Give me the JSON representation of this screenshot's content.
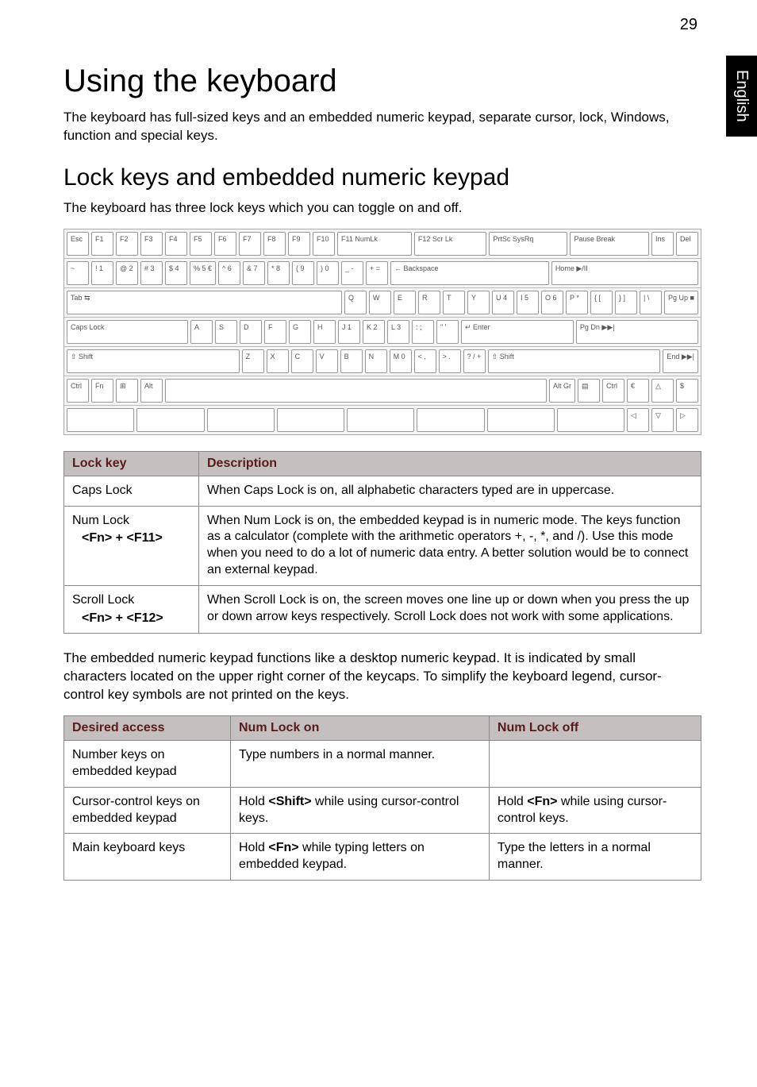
{
  "page_number": "29",
  "side_tab": "English",
  "h1": "Using the keyboard",
  "intro": "The keyboard has full-sized keys and an embedded numeric keypad, separate cursor, lock, Windows, function and special keys.",
  "h2": "Lock keys and embedded numeric keypad",
  "sub_intro": "The keyboard has three lock keys which you can toggle on and off.",
  "keyboard_rows": [
    [
      "Esc",
      "F1",
      "F2",
      "F3",
      "F4",
      "F5",
      "F6",
      "F7",
      "F8",
      "F9",
      "F10",
      "F11 NumLk",
      "F12 Scr Lk",
      "PrtSc SysRq",
      "Pause Break",
      "Ins",
      "Del"
    ],
    [
      "~",
      "! 1",
      "@ 2",
      "# 3",
      "$ 4",
      "% 5 €",
      "^ 6",
      "& 7",
      "* 8",
      "( 9",
      ") 0",
      "_ -",
      "+ =",
      "← Backspace",
      "Home ▶/II"
    ],
    [
      "Tab ⇆",
      "Q",
      "W",
      "E",
      "R",
      "T",
      "Y",
      "U 4",
      "I 5",
      "O 6",
      "P *",
      "{ [",
      "} ]",
      "| \\",
      "Pg Up ■"
    ],
    [
      "Caps Lock",
      "A",
      "S",
      "D",
      "F",
      "G",
      "H",
      "J 1",
      "K 2",
      "L 3",
      ": ;",
      "\" '",
      "↵ Enter",
      "Pg Dn ▶▶|"
    ],
    [
      "⇧ Shift",
      "Z",
      "X",
      "C",
      "V",
      "B",
      "N",
      "M 0",
      "< ,",
      ">  .",
      "? /  +",
      "⇧ Shift",
      "End ▶▶|"
    ],
    [
      "Ctrl",
      "Fn",
      "⊞",
      "Alt",
      "",
      "Alt Gr",
      "▤",
      "Ctrl",
      "€",
      "△",
      "$"
    ],
    [
      "",
      "",
      "",
      "",
      "",
      "",
      "",
      "",
      "◁",
      "▽",
      "▷"
    ]
  ],
  "table1": {
    "headers": [
      "Lock key",
      "Description"
    ],
    "rows": [
      {
        "key_line1": "Caps Lock",
        "key_line2": "",
        "desc": "When Caps Lock is on, all alphabetic characters typed are in uppercase."
      },
      {
        "key_line1": "Num Lock",
        "key_line2": "<Fn> + <F11>",
        "desc": "When Num Lock is on, the embedded keypad is in numeric mode. The keys function as a calculator (complete with the arithmetic operators +, -, *, and /). Use this mode when you need to do a lot of numeric data entry. A better solution would be to connect an external keypad."
      },
      {
        "key_line1": "Scroll Lock",
        "key_line2": "<Fn> + <F12>",
        "desc": "When Scroll Lock is on, the screen moves one line up or down when you press the up or down arrow keys respectively. Scroll Lock does not work with some applications."
      }
    ]
  },
  "mid_para": "The embedded numeric keypad functions like a desktop numeric keypad. It is indicated by small characters located on the upper right corner of the keycaps. To simplify the keyboard legend, cursor-control key symbols are not printed on the keys.",
  "table2": {
    "headers": [
      "Desired access",
      "Num Lock on",
      "Num Lock off"
    ],
    "rows": [
      {
        "c1": "Number keys on embedded keypad",
        "c2": "Type numbers in a normal manner.",
        "c3": ""
      },
      {
        "c1": "Cursor-control keys on embedded keypad",
        "c2": "Hold <Shift> while using cursor-control keys.",
        "c3": "Hold <Fn> while using cursor-control keys."
      },
      {
        "c1": "Main keyboard keys",
        "c2": "Hold <Fn> while typing letters on embedded keypad.",
        "c3": "Type the letters in a normal manner."
      }
    ]
  },
  "chart_data": {
    "type": "table",
    "tables": [
      {
        "title": "Lock keys",
        "columns": [
          "Lock key",
          "Description"
        ],
        "rows": [
          [
            "Caps Lock",
            "When Caps Lock is on, all alphabetic characters typed are in uppercase."
          ],
          [
            "Num Lock <Fn> + <F11>",
            "When Num Lock is on, the embedded keypad is in numeric mode. The keys function as a calculator (complete with the arithmetic operators +, -, *, and /). Use this mode when you need to do a lot of numeric data entry. A better solution would be to connect an external keypad."
          ],
          [
            "Scroll Lock <Fn> + <F12>",
            "When Scroll Lock is on, the screen moves one line up or down when you press the up or down arrow keys respectively. Scroll Lock does not work with some applications."
          ]
        ]
      },
      {
        "title": "Embedded keypad access",
        "columns": [
          "Desired access",
          "Num Lock on",
          "Num Lock off"
        ],
        "rows": [
          [
            "Number keys on embedded keypad",
            "Type numbers in a normal manner.",
            ""
          ],
          [
            "Cursor-control keys on embedded keypad",
            "Hold <Shift> while using cursor-control keys.",
            "Hold <Fn> while using cursor-control keys."
          ],
          [
            "Main keyboard keys",
            "Hold <Fn> while typing letters on embedded keypad.",
            "Type the letters in a normal manner."
          ]
        ]
      }
    ]
  }
}
